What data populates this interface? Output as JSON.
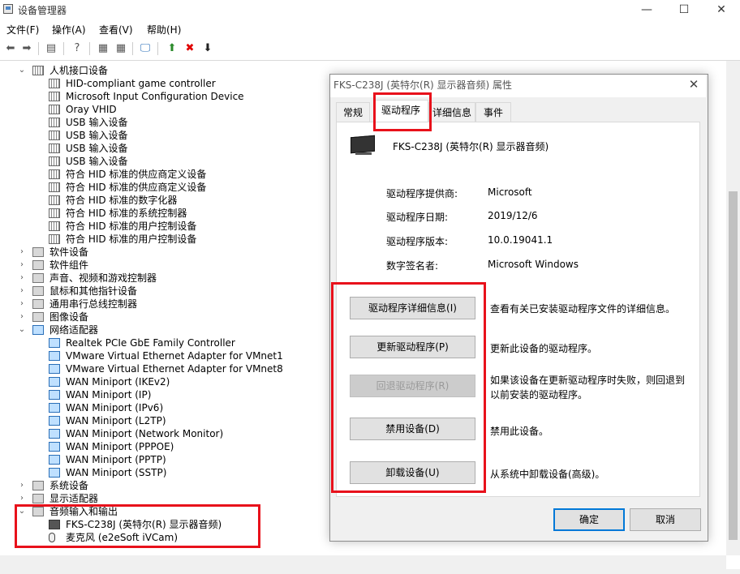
{
  "window": {
    "title": "设备管理器",
    "controls": {
      "minimize": "—",
      "maximize": "☐",
      "close": "✕"
    }
  },
  "menu": [
    "文件(F)",
    "操作(A)",
    "查看(V)",
    "帮助(H)"
  ],
  "toolbar": {
    "icons": [
      "back-arrow-icon",
      "forward-arrow-icon",
      "properties-icon",
      "help-icon",
      "view-icon",
      "scan-monitor-icon",
      "update-driver-icon",
      "uninstall-icon",
      "disable-icon"
    ],
    "glyphs": {
      "back": "⬅",
      "forward": "➡",
      "properties": "▤",
      "help": "?",
      "view": "▦",
      "scan": "🖵",
      "update": "⬆",
      "uninstall": "✖",
      "disable": "⬇"
    }
  },
  "tree": {
    "hid_category": "人机接口设备",
    "hid_items": [
      "HID-compliant game controller",
      "Microsoft Input Configuration Device",
      "Oray VHID",
      "USB 输入设备",
      "USB 输入设备",
      "USB 输入设备",
      "USB 输入设备",
      "符合 HID 标准的供应商定义设备",
      "符合 HID 标准的供应商定义设备",
      "符合 HID 标准的数字化器",
      "符合 HID 标准的系统控制器",
      "符合 HID 标准的用户控制设备",
      "符合 HID 标准的用户控制设备"
    ],
    "collapsed_categories_1": [
      "软件设备",
      "软件组件",
      "声音、视频和游戏控制器",
      "鼠标和其他指针设备",
      "通用串行总线控制器",
      "图像设备"
    ],
    "network_category": "网络适配器",
    "network_items": [
      "Realtek PCIe GbE Family Controller",
      "VMware Virtual Ethernet Adapter for VMnet1",
      "VMware Virtual Ethernet Adapter for VMnet8",
      "WAN Miniport (IKEv2)",
      "WAN Miniport (IP)",
      "WAN Miniport (IPv6)",
      "WAN Miniport (L2TP)",
      "WAN Miniport (Network Monitor)",
      "WAN Miniport (PPPOE)",
      "WAN Miniport (PPTP)",
      "WAN Miniport (SSTP)"
    ],
    "collapsed_categories_2": [
      "系统设备",
      "显示适配器"
    ],
    "audio_category": "音频输入和输出",
    "audio_items": [
      "FKS-C238J (英特尔(R) 显示器音频)",
      "麦克风 (e2eSoft iVCam)"
    ]
  },
  "dialog": {
    "title": "FKS-C238J (英特尔(R) 显示器音频) 属性",
    "close": "✕",
    "tabs": [
      "常规",
      "驱动程序",
      "详细信息",
      "事件"
    ],
    "active_tab": "驱动程序",
    "device_name": "FKS-C238J (英特尔(R) 显示器音频)",
    "properties": [
      {
        "label": "驱动程序提供商:",
        "value": "Microsoft"
      },
      {
        "label": "驱动程序日期:",
        "value": "2019/12/6"
      },
      {
        "label": "驱动程序版本:",
        "value": "10.0.19041.1"
      },
      {
        "label": "数字签名者:",
        "value": "Microsoft Windows"
      }
    ],
    "actions": [
      {
        "label": "驱动程序详细信息(I)",
        "desc": "查看有关已安装驱动程序文件的详细信息。",
        "enabled": true
      },
      {
        "label": "更新驱动程序(P)",
        "desc": "更新此设备的驱动程序。",
        "enabled": true
      },
      {
        "label": "回退驱动程序(R)",
        "desc": "如果该设备在更新驱动程序时失败，则回退到以前安装的驱动程序。",
        "enabled": false
      },
      {
        "label": "禁用设备(D)",
        "desc": "禁用此设备。",
        "enabled": true
      },
      {
        "label": "卸载设备(U)",
        "desc": "从系统中卸载设备(高级)。",
        "enabled": true
      }
    ],
    "ok": "确定",
    "cancel": "取消"
  },
  "highlight_color": "#e8111b"
}
